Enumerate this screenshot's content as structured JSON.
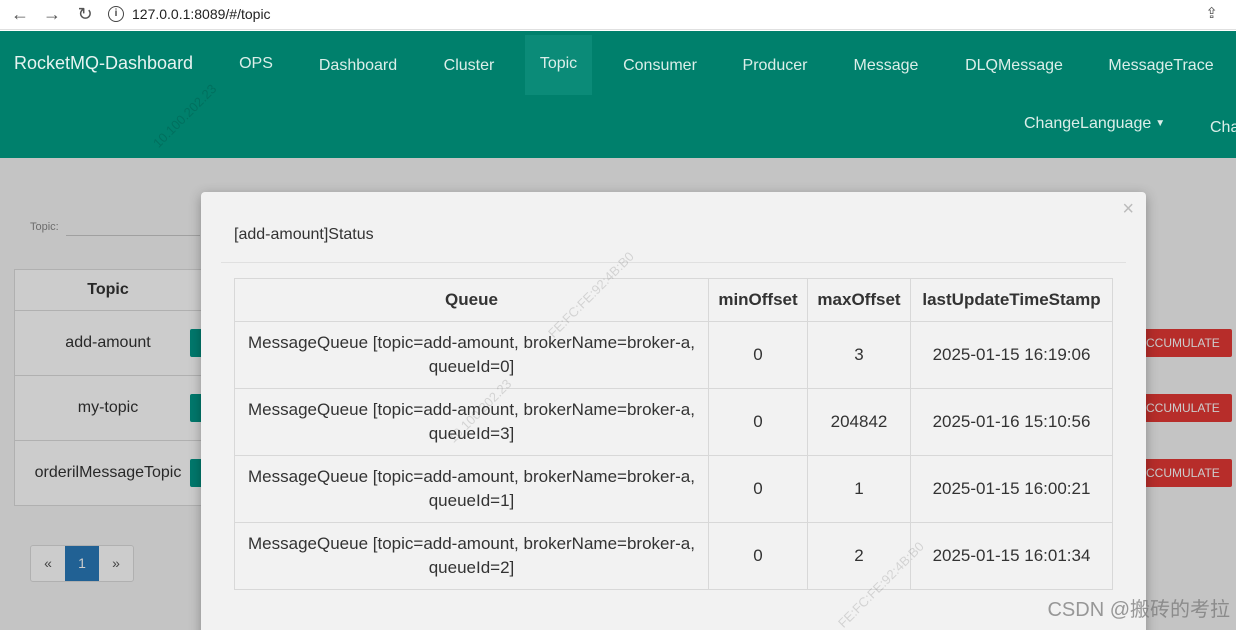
{
  "browser": {
    "back_icon": "back-arrow-icon",
    "forward_icon": "forward-arrow-icon",
    "reload_icon": "reload-icon",
    "url": "127.0.0.1:8089/#/topic"
  },
  "header": {
    "brand": "RocketMQ-Dashboard",
    "nav": [
      "OPS",
      "Dashboard",
      "Cluster",
      "Topic",
      "Consumer",
      "Producer",
      "Message",
      "DLQMessage",
      "MessageTrace"
    ],
    "active_nav": "Topic",
    "change_language": "ChangeLanguage",
    "truncated_item": "Cha"
  },
  "page": {
    "topic_filter_label": "Topic:",
    "table_header": "Topic",
    "topics": [
      "add-amount",
      "my-topic",
      "orderilMessageTopic"
    ],
    "accumulate_label": "CCUMULATE",
    "pager": {
      "prev": "«",
      "current": "1",
      "next": "»"
    }
  },
  "modal": {
    "title": "[add-amount]Status",
    "close": "×",
    "columns": [
      "Queue",
      "minOffset",
      "maxOffset",
      "lastUpdateTimeStamp"
    ],
    "rows": [
      {
        "queue": "MessageQueue [topic=add-amount, brokerName=broker-a, queueId=0]",
        "minOffset": "0",
        "maxOffset": "3",
        "lastUpdateTimeStamp": "2025-01-15 16:19:06"
      },
      {
        "queue": "MessageQueue [topic=add-amount, brokerName=broker-a, queueId=3]",
        "minOffset": "0",
        "maxOffset": "204842",
        "lastUpdateTimeStamp": "2025-01-16 15:10:56"
      },
      {
        "queue": "MessageQueue [topic=add-amount, brokerName=broker-a, queueId=1]",
        "minOffset": "0",
        "maxOffset": "1",
        "lastUpdateTimeStamp": "2025-01-15 16:00:21"
      },
      {
        "queue": "MessageQueue [topic=add-amount, brokerName=broker-a, queueId=2]",
        "minOffset": "0",
        "maxOffset": "2",
        "lastUpdateTimeStamp": "2025-01-15 16:01:34"
      }
    ]
  },
  "watermarks": {
    "ip": "10.100.202.23",
    "mac": "FE:FC:FE:92:4B:B0",
    "csdn": "CSDN @搬砖的考拉"
  }
}
